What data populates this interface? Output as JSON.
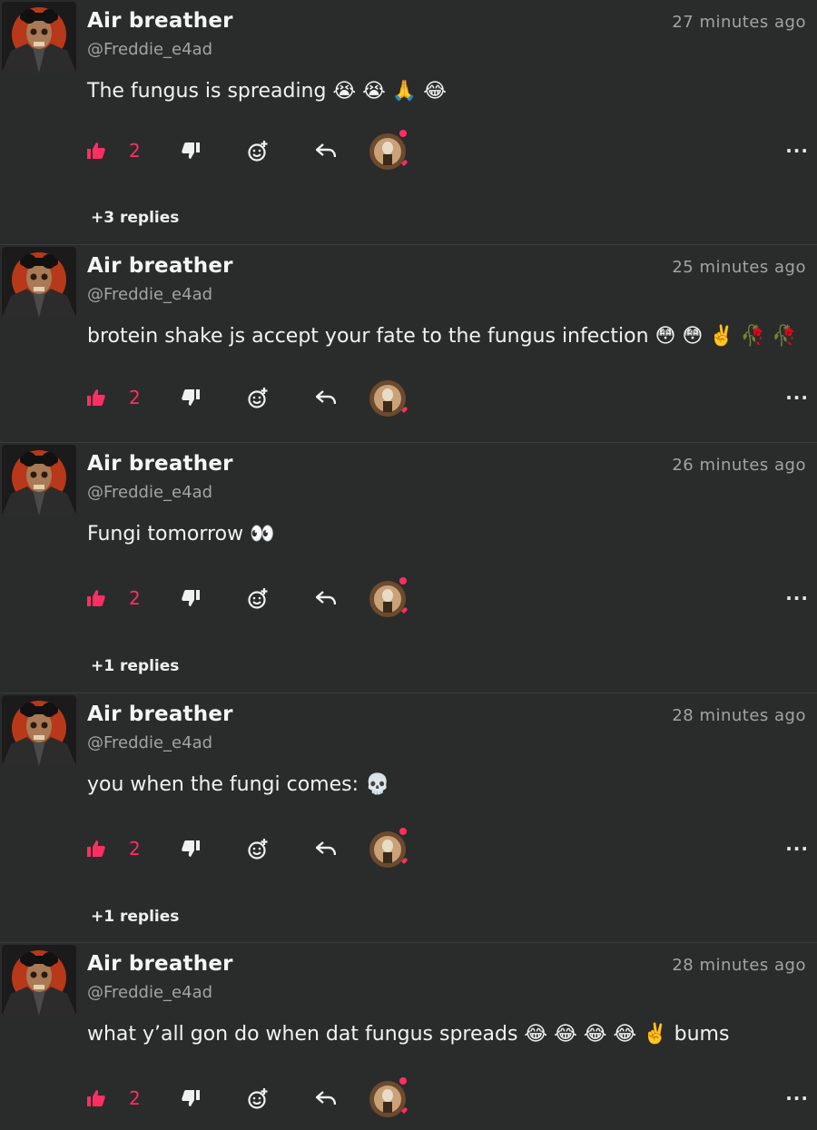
{
  "comments": [
    {
      "author": "Air breather",
      "handle": "@Freddie_e4ad",
      "time": "27 minutes ago",
      "text": "The fungus is spreading 😭 😭 🙏 😂",
      "likes": "2",
      "replies": "+3 replies"
    },
    {
      "author": "Air breather",
      "handle": "@Freddie_e4ad",
      "time": "25 minutes ago",
      "text": "brotein shake js accept your fate to the fungus infection 😳 😳 ✌️ 🥀 🥀",
      "likes": "2"
    },
    {
      "author": "Air breather",
      "handle": "@Freddie_e4ad",
      "time": "26 minutes ago",
      "text": "Fungi tomorrow 👀",
      "likes": "2",
      "replies": "+1 replies"
    },
    {
      "author": "Air breather",
      "handle": "@Freddie_e4ad",
      "time": "28 minutes ago",
      "text": "you when the fungi comes: 💀",
      "likes": "2",
      "replies": "+1 replies"
    },
    {
      "author": "Air breather",
      "handle": "@Freddie_e4ad",
      "time": "28 minutes ago",
      "text": "what y’all gon do when dat fungus spreads 😂 😂 😂 😂 ✌️ bums",
      "likes": "2"
    }
  ],
  "colors": {
    "background": "#2a2c2b",
    "accent": "#ff2e63",
    "muted": "#a2a4a3"
  },
  "icons": {
    "like": "thumbs-up-icon",
    "dislike": "thumbs-down-icon",
    "react": "add-reaction-icon",
    "reply": "reply-arrow-icon",
    "more": "more-options-icon"
  },
  "more_label": "···"
}
